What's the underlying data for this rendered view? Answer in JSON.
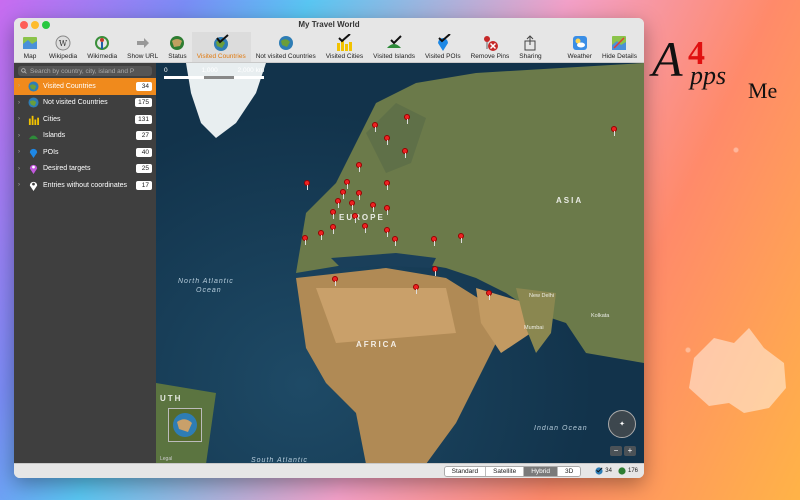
{
  "window": {
    "title": "My Travel World"
  },
  "toolbar": {
    "items": [
      {
        "label": "Map",
        "icon": "map-icon"
      },
      {
        "label": "Wikipedia",
        "icon": "wikipedia-icon"
      },
      {
        "label": "Wikimedia",
        "icon": "wikimedia-icon"
      },
      {
        "label": "Show URL",
        "icon": "arrow-right-icon"
      },
      {
        "label": "Status",
        "icon": "globe-icon"
      },
      {
        "label": "Visited Countries",
        "icon": "globe-check-icon",
        "active": true
      },
      {
        "label": "Not visited Countries",
        "icon": "globe-icon"
      },
      {
        "label": "Visited Cities",
        "icon": "city-check-icon"
      },
      {
        "label": "Visited Islands",
        "icon": "island-check-icon"
      },
      {
        "label": "Visited POIs",
        "icon": "poi-check-icon"
      },
      {
        "label": "Remove Pins",
        "icon": "remove-pin-icon"
      },
      {
        "label": "Sharing",
        "icon": "share-icon"
      },
      {
        "label": "Weather",
        "icon": "weather-icon"
      },
      {
        "label": "Hide Details",
        "icon": "hide-details-icon"
      }
    ]
  },
  "sidebar": {
    "search_placeholder": "Search by country, city, island and P",
    "items": [
      {
        "label": "Visited Countries",
        "count": "34",
        "icon": "globe-icon",
        "selected": true
      },
      {
        "label": "Not visited Countries",
        "count": "175",
        "icon": "globe-icon"
      },
      {
        "label": "Cities",
        "count": "131",
        "icon": "city-icon"
      },
      {
        "label": "Islands",
        "count": "27",
        "icon": "island-icon"
      },
      {
        "label": "POIs",
        "count": "40",
        "icon": "poi-icon"
      },
      {
        "label": "Desired targets",
        "count": "25",
        "icon": "target-icon"
      },
      {
        "label": "Entries without coordinates",
        "count": "17",
        "icon": "location-pin-icon"
      }
    ]
  },
  "map": {
    "scale_labels": [
      "0",
      "1,000",
      "2,000 km"
    ],
    "labels": {
      "europe": "EUROPE",
      "asia": "ASIA",
      "africa": "AFRICA",
      "north_atlantic": "North Atlantic",
      "ocean1": "Ocean",
      "indian_ocean": "Indian Ocean",
      "south_atlantic": "South Atlantic",
      "new_delhi": "New Delhi",
      "mumbai": "Mumbai",
      "kolkata": "Kolkata",
      "uth": "UTH"
    },
    "legal": "Legal"
  },
  "status": {
    "map_types": [
      "Standard",
      "Satellite",
      "Hybrid",
      "3D"
    ],
    "selected_map_type": "Hybrid",
    "visited_count": "34",
    "not_visited_count": "176"
  },
  "brand": {
    "text": "Apps4Me"
  }
}
